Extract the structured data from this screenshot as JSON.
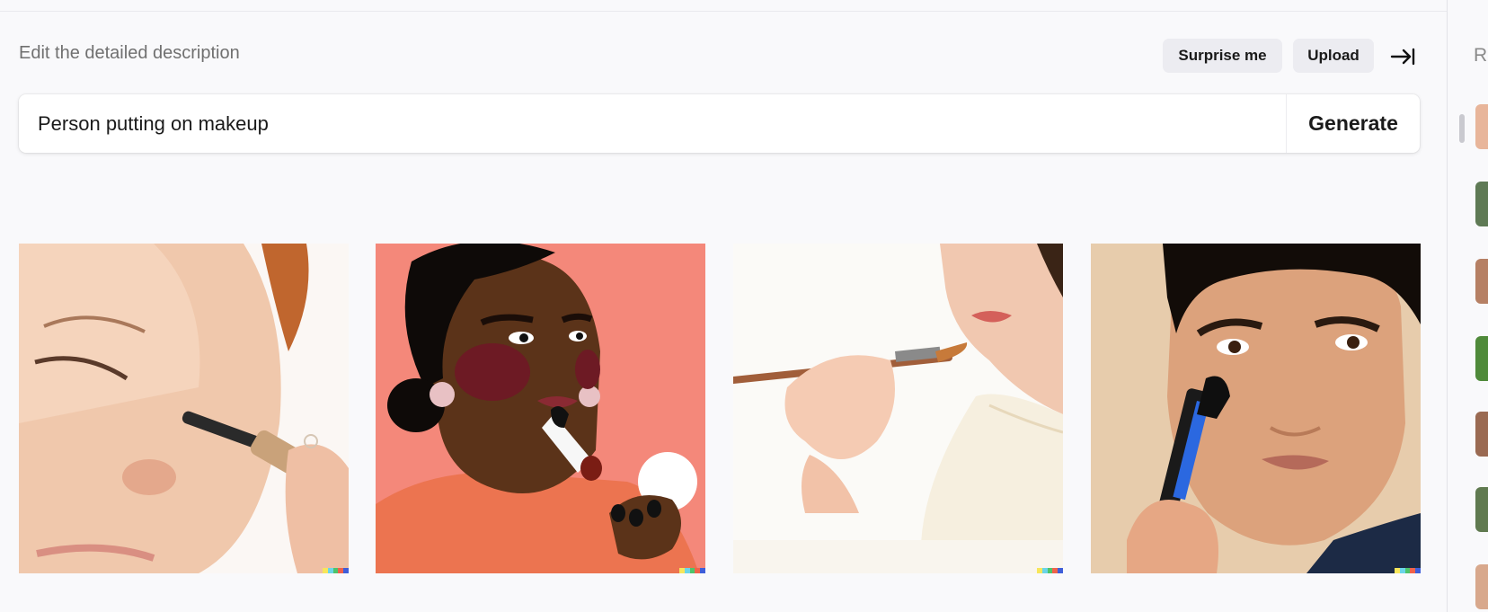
{
  "header": {
    "description_label": "Edit the detailed description",
    "surprise_label": "Surprise me",
    "upload_label": "Upload"
  },
  "prompt": {
    "value": "Person putting on makeup",
    "generate_label": "Generate"
  },
  "results": [
    {
      "name": "Photo of woman applying mascara"
    },
    {
      "name": "Illustration of woman applying lipstick"
    },
    {
      "name": "Photo of woman holding makeup brush"
    },
    {
      "name": "Photo of man applying concealer"
    }
  ],
  "sidebar": {
    "title_initial": "R"
  },
  "colors": {
    "accent": "#1a1a1a",
    "pill_bg": "#ececf1",
    "page_bg": "#f9f9fb"
  }
}
